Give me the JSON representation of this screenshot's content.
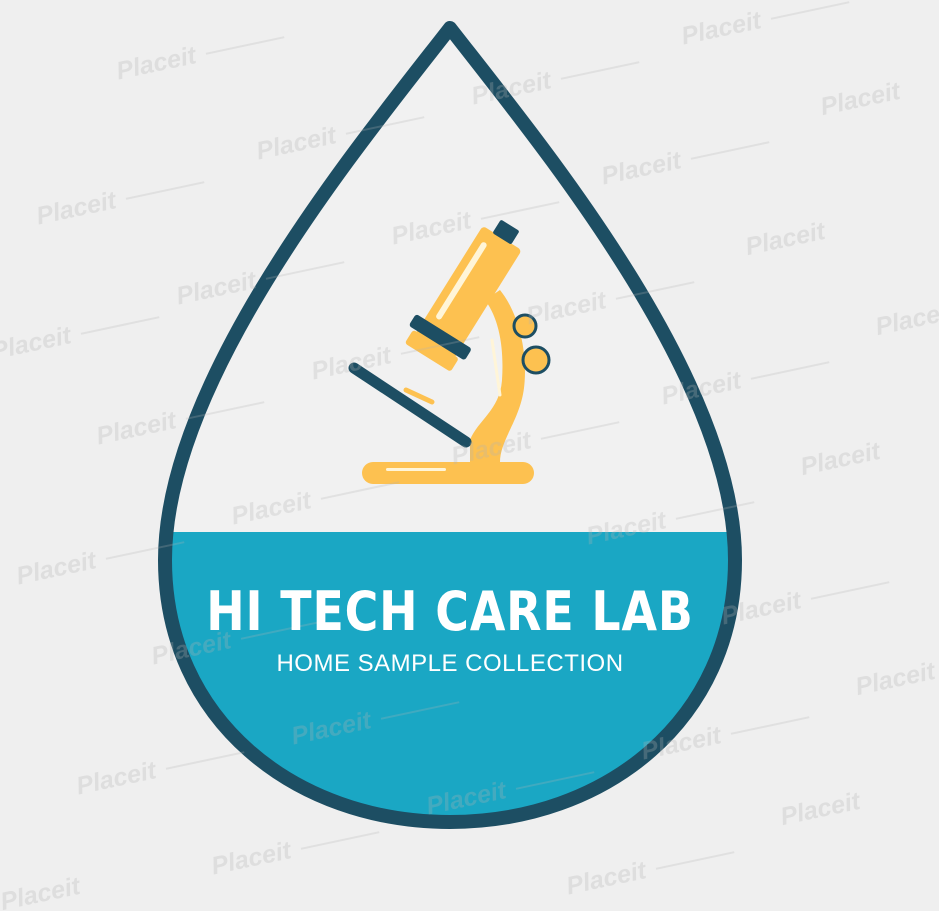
{
  "brand": {
    "name": "HI TECH CARE LAB",
    "tagline": "HOME SAMPLE COLLECTION"
  },
  "watermark": {
    "text": "Placeit"
  },
  "icons": {
    "emblem": "microscope-icon",
    "container": "water-drop-shape"
  },
  "colors": {
    "background": "#efefef",
    "drop_outline": "#1d4e63",
    "drop_fill_lower": "#1aa7c4",
    "drop_fill_upper": "#f0f0f0",
    "microscope_yellow": "#fdc150",
    "microscope_dark": "#1d4e63",
    "text": "#ffffff"
  }
}
